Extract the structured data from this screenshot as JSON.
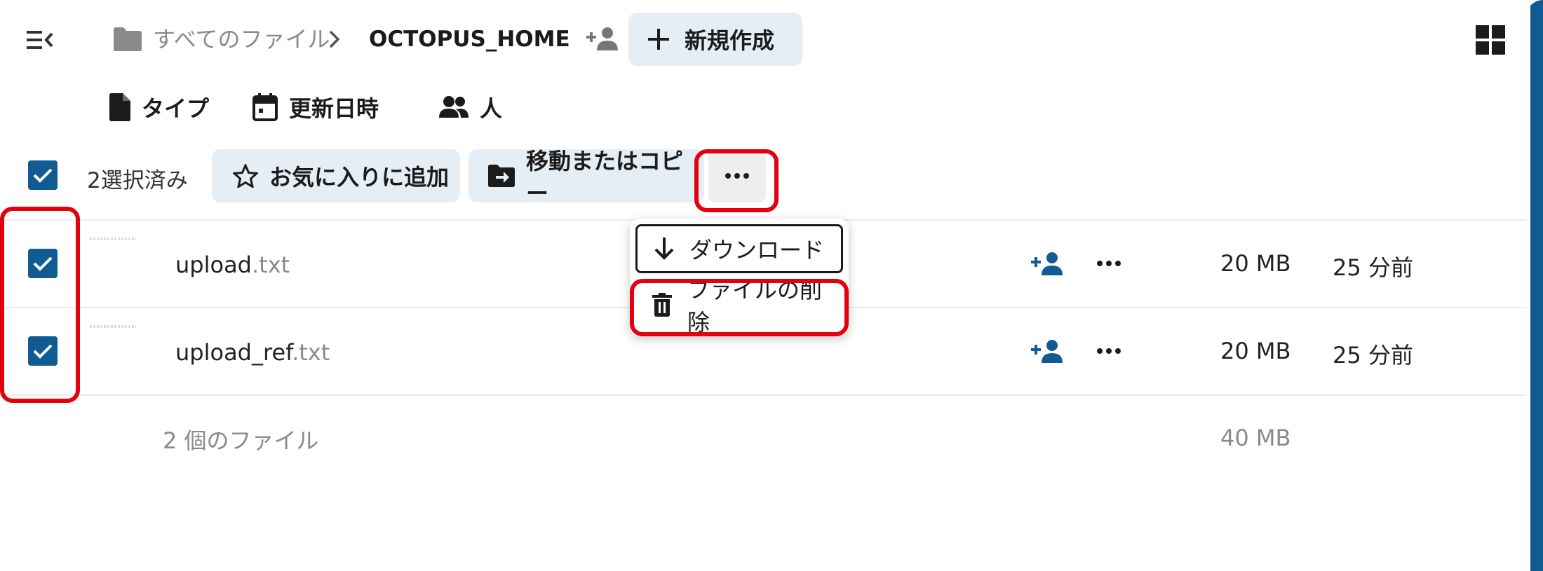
{
  "header": {
    "breadcrumb": {
      "root": "すべてのファイル",
      "current": "OCTOPUS_HOME"
    },
    "new_button": "新規作成"
  },
  "filters": {
    "type": "タイプ",
    "modified": "更新日時",
    "people": "人"
  },
  "selection": {
    "count_label": "2選択済み",
    "favorite_button": "お気に入りに追加",
    "move_copy_button": "移動またはコピー"
  },
  "files": [
    {
      "name": "upload",
      "ext": ".txt",
      "size": "20 MB",
      "modified": "25 分前",
      "selected": true
    },
    {
      "name": "upload_ref",
      "ext": ".txt",
      "size": "20 MB",
      "modified": "25 分前",
      "selected": true
    }
  ],
  "summary": {
    "count": "2 個のファイル",
    "total_size": "40 MB"
  },
  "menu": {
    "download": "ダウンロード",
    "delete": "ファイルの削除"
  },
  "colors": {
    "primary": "#0f5b92",
    "highlight": "#e3000f",
    "pill": "#e6eef5"
  },
  "icons": [
    "menu-collapse-icon",
    "folder-icon",
    "chevron-right-icon",
    "share-person-icon",
    "plus-icon",
    "grid-view-icon",
    "file-icon",
    "calendar-icon",
    "people-icon",
    "checkbox-icon",
    "star-icon",
    "folder-move-icon",
    "dots-icon",
    "download-arrow-icon",
    "trash-icon"
  ]
}
